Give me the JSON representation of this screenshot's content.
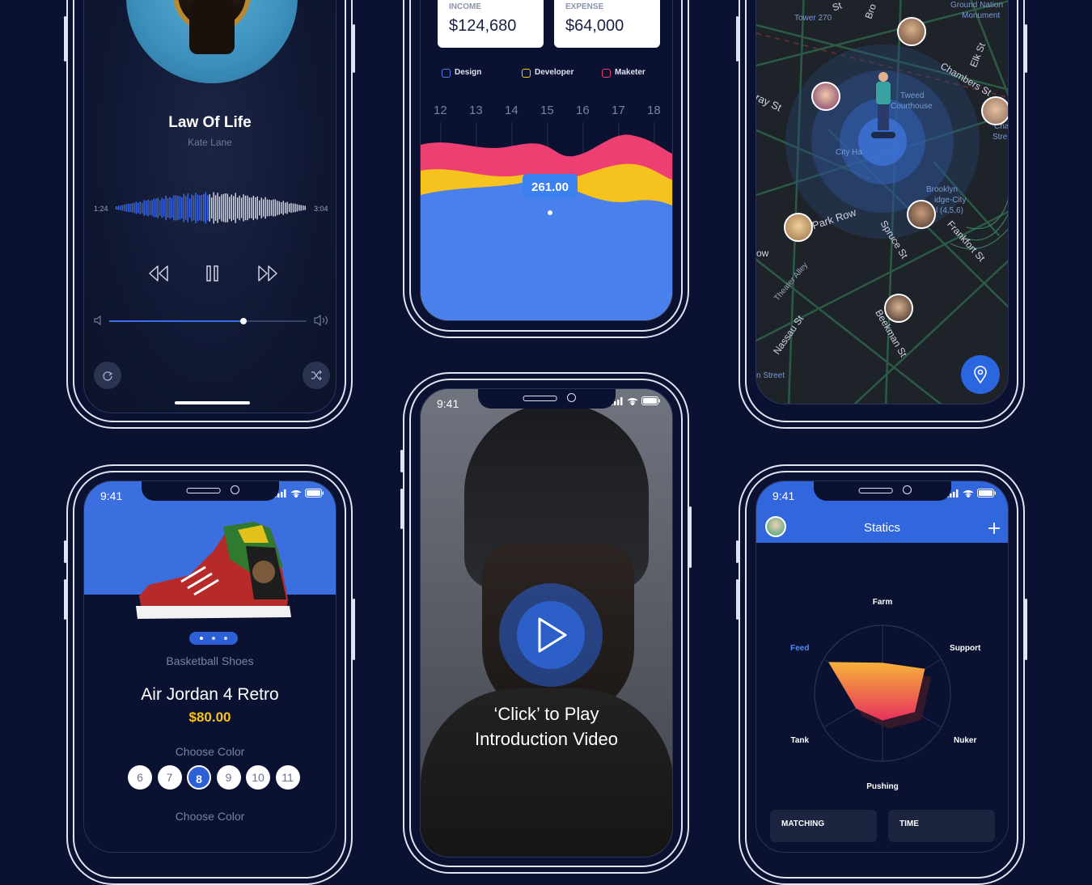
{
  "status": {
    "time": "9:41"
  },
  "music": {
    "title": "Law Of Life",
    "artist": "Kate Lane",
    "elapsed": "1:24",
    "duration": "3:04",
    "volume": 0.68
  },
  "finance": {
    "income_label": "INCOME",
    "income_value": "$124,680",
    "expense_label": "EXPENSE",
    "expense_value": "$64,000",
    "legend": [
      {
        "label": "Design",
        "color": "#4f7ee8"
      },
      {
        "label": "Developer",
        "color": "#f5c518"
      },
      {
        "label": "Maketer",
        "color": "#ef3b72"
      }
    ],
    "days": [
      "12",
      "13",
      "14",
      "15",
      "16",
      "17",
      "18"
    ],
    "tooltip": "261.00",
    "colors": {
      "blue": "#4a80ec",
      "yellow": "#f6c21d",
      "red": "#ee3f72"
    }
  },
  "map": {
    "labels": {
      "ground_nation": "Ground Nation",
      "monument": "Monument",
      "tower": "Tower 270",
      "chambers": "Chambers St",
      "elk": "Elk St",
      "tweed": "Tweed",
      "courthouse": "Courthouse",
      "city_hall": "City Ha",
      "cha": "Cha",
      "stre": "Stre",
      "brooklyn": "Brooklyn",
      "bridge_city": "idge-City",
      "lines": "l (4,5,6)",
      "park_row": "Park Row",
      "spruce": "Spruce St",
      "frankfort": "Frankfort St",
      "theater": "Theater Alley",
      "nassau": "Nassau St",
      "beekman": "Beekman St",
      "murray": "ray St",
      "n_street": "n Street",
      "ow": "ow",
      "bro": "Bro",
      "st": "St"
    }
  },
  "video": {
    "caption_line1": "‘Click’ to Play",
    "caption_line2": "Introduction Video"
  },
  "shop": {
    "category": "Basketball Shoes",
    "name": "Air Jordan 4 Retro",
    "price": "$80.00",
    "choose_color": "Choose Color",
    "sizes": [
      "6",
      "7",
      "8",
      "9",
      "10",
      "11"
    ],
    "selected_size": "8",
    "choose_color_2": "Choose Color"
  },
  "stats": {
    "title": "Statics",
    "axes": [
      "Farm",
      "Support",
      "Nuker",
      "Pushing",
      "Tank",
      "Feed"
    ],
    "highlight_axis": "Feed",
    "values": [
      0.45,
      0.72,
      0.55,
      0.4,
      0.45,
      0.92
    ],
    "tabs": [
      "MATCHING",
      "TIME"
    ]
  }
}
